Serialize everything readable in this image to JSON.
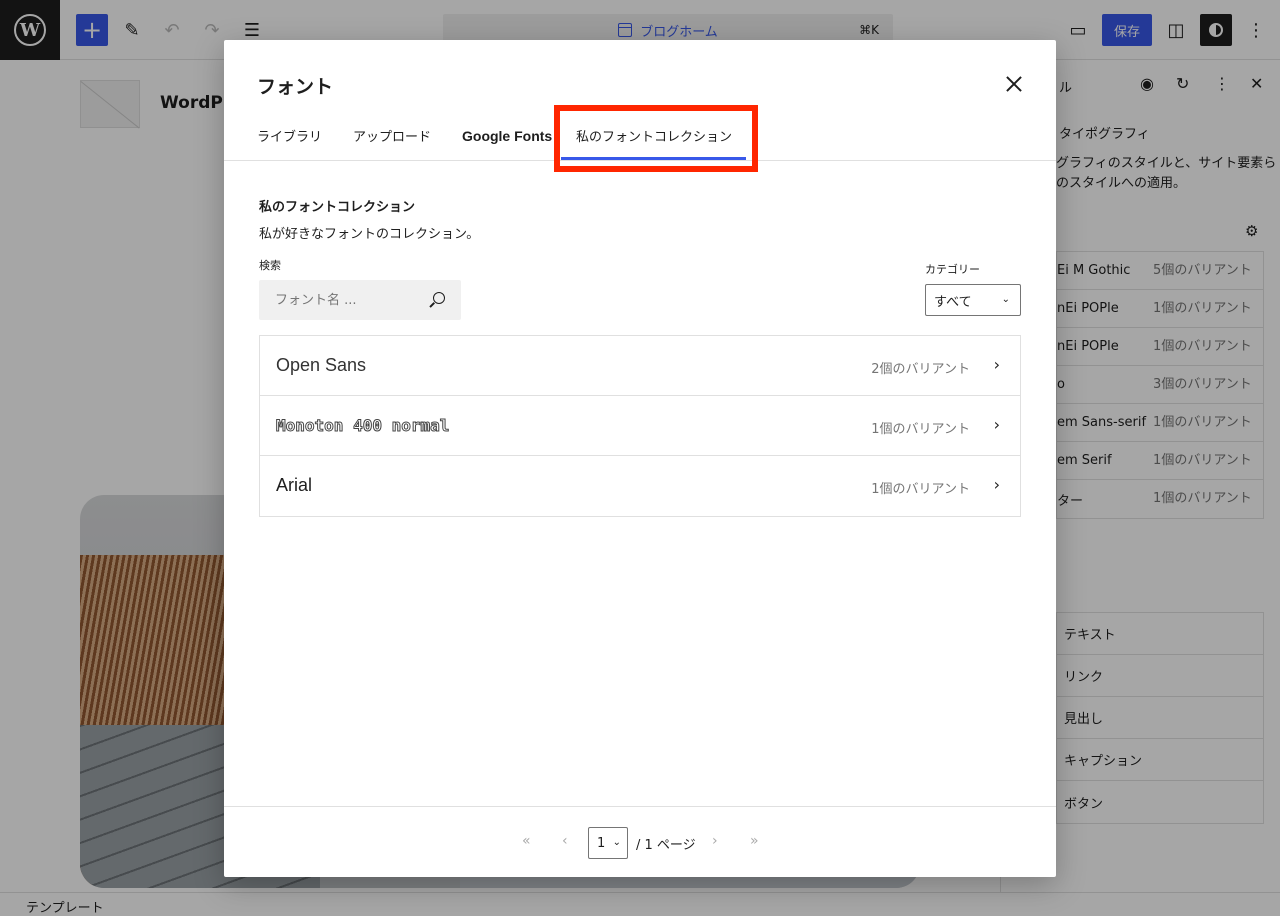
{
  "editor": {
    "command_bar": {
      "label": "ブログホーム",
      "shortcut": "⌘K"
    },
    "save_label": "保存",
    "site_title": "WordPr",
    "status_bar": "テンプレート"
  },
  "sidebar": {
    "title": "ル",
    "typography_label": "タイポグラフィ",
    "description": "グラフィのスタイルと、サイト要素らのスタイルへの適用。",
    "fonts": [
      {
        "name": "Ei M Gothic",
        "variants": "5個のバリアント"
      },
      {
        "name": "nEi POPle",
        "variants": "1個のバリアント"
      },
      {
        "name": "nEi POPle",
        "variants": "1個のバリアント"
      },
      {
        "name": "o",
        "variants": "3個のバリアント"
      },
      {
        "name": "em Sans-serif",
        "variants": "1個のバリアント"
      },
      {
        "name": "em Serif",
        "variants": "1個のバリアント"
      },
      {
        "name": "ター",
        "variants": "1個のバリアント"
      }
    ],
    "elements": [
      "テキスト",
      "リンク",
      "見出し",
      "キャプション",
      "ボタン"
    ]
  },
  "modal": {
    "title": "フォント",
    "tabs": [
      "ライブラリ",
      "アップロード",
      "Google Fonts",
      "私のフォントコレクション"
    ],
    "active_tab": "私のフォントコレクション",
    "section_title": "私のフォントコレクション",
    "section_description": "私が好きなフォントのコレクション。",
    "search": {
      "label": "検索",
      "placeholder": "フォント名 ..."
    },
    "category": {
      "label": "カテゴリー",
      "value": "すべて"
    },
    "fonts": [
      {
        "name": "Open Sans",
        "variants": "2個のバリアント"
      },
      {
        "name": "Monoton 400 normal",
        "variants": "1個のバリアント"
      },
      {
        "name": "Arial",
        "variants": "1個のバリアント"
      }
    ],
    "pagination": {
      "current": "1",
      "total": "/ 1 ページ",
      "first": "«",
      "prev": "‹",
      "next": "›",
      "last": "»"
    }
  },
  "colors": {
    "accent": "#3858e9",
    "highlight": "#ff2600"
  }
}
